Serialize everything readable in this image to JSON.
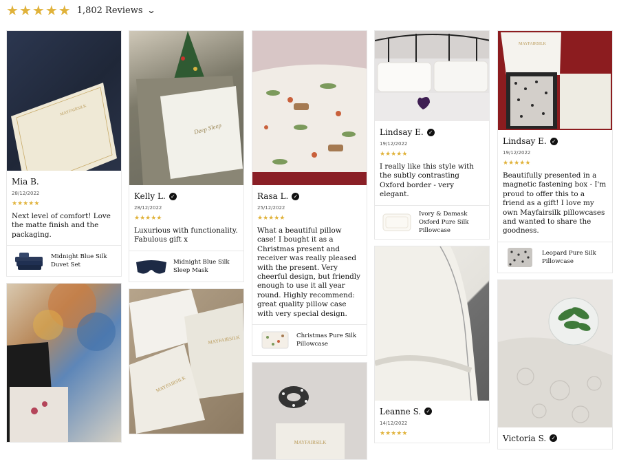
{
  "summary": {
    "rating_stars": 5,
    "count_label": "1,802 Reviews"
  },
  "reviews": [
    {
      "name": "Mia B.",
      "verified": false,
      "date": "28/12/2022",
      "text": "Next level of comfort! Love the matte finish and the packaging.",
      "product": "Midnight Blue Silk Duvet Set"
    },
    {
      "name": "Kelly L.",
      "verified": true,
      "date": "28/12/2022",
      "text": "Luxurious with functionality. Fabulous gift x",
      "product": "Midnight Blue Silk Sleep Mask"
    },
    {
      "name": "Rasa L.",
      "verified": true,
      "date": "25/12/2022",
      "text": "What a beautiful pillow case! I bought it as a Christmas present and receiver was really pleased with the present. Very cheerful design, but friendly enough to use it all year round. Highly recommend: great quality pillow case with very special design.",
      "product": "Christmas Pure Silk Pillowcase"
    },
    {
      "name": "Lindsay E.",
      "verified": true,
      "date": "19/12/2022",
      "text": "I really like this style with the subtly contrasting Oxford border - very elegant.",
      "product": "Ivory & Damask Oxford Pure Silk Pillowcase"
    },
    {
      "name": "Lindsay E.",
      "verified": true,
      "date": "19/12/2022",
      "text": "Beautifully presented in a magnetic fastening box - I'm proud to offer this to a friend as a gift! I love my own Mayfairsilk pillowcases and wanted to share the goodness.",
      "product": "Leopard Pure Silk Pillowcase"
    },
    {
      "name": "Leanne S.",
      "verified": true,
      "date": "14/12/2022"
    },
    {
      "name": "Victoria S.",
      "verified": true
    }
  ],
  "brand_on_boxes": "MAYFAIRSILK",
  "colors": {
    "star": "#e0b23a",
    "border": "#e8e8e8"
  }
}
